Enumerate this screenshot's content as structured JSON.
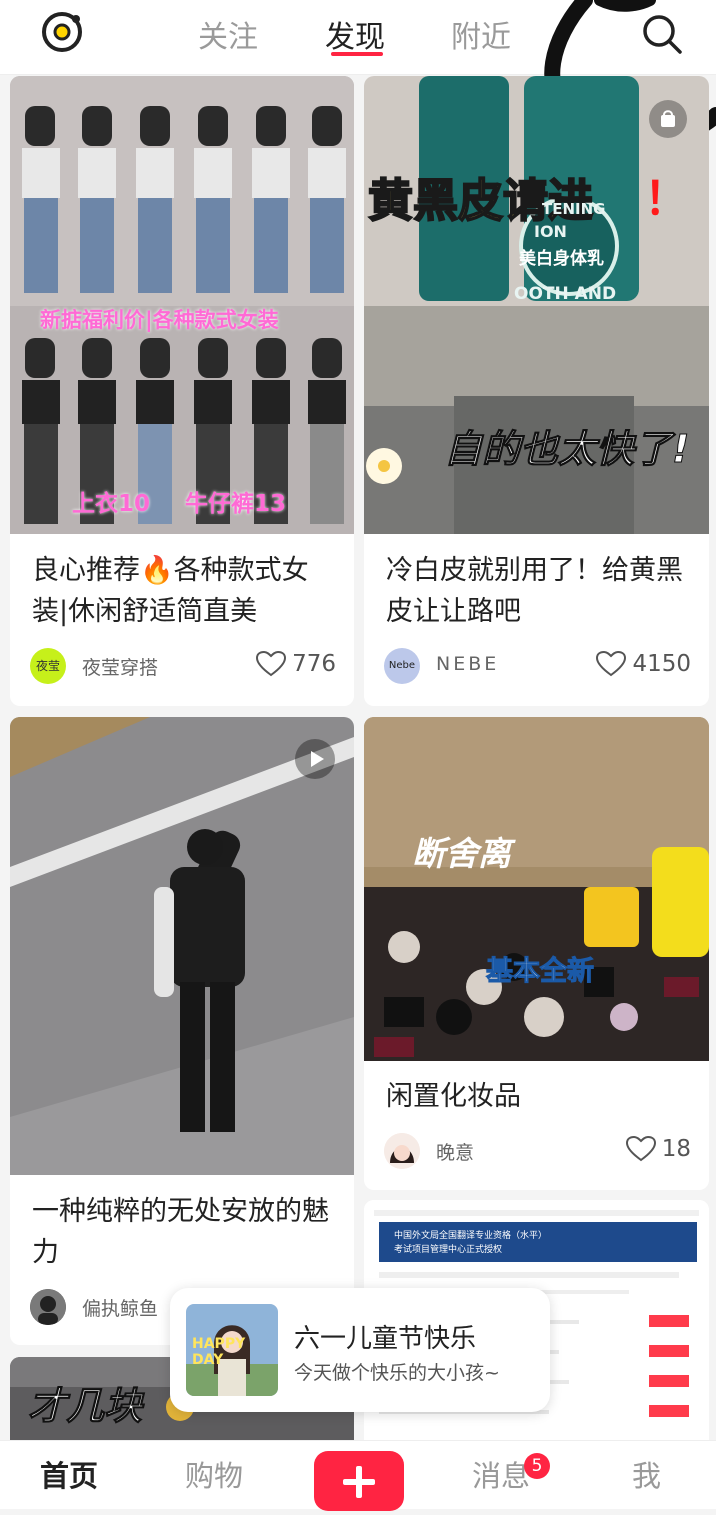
{
  "header": {
    "tabs": [
      {
        "label": "关注",
        "active": false
      },
      {
        "label": "发现",
        "active": true
      },
      {
        "label": "附近",
        "active": false
      }
    ],
    "accent_color": "#ff2442"
  },
  "feed": [
    {
      "image_text": [
        "新掂福利价|各种款式女装",
        "上衣10",
        "牛仔裤13"
      ],
      "title": "良心推荐🔥各种款式女装|休闲舒适简直美",
      "author": "夜莹穿搭",
      "author_avatar_text": "夜莹",
      "likes": "776"
    },
    {
      "image_text": [
        "黄黑皮请进",
        "！",
        "自的也太快了!",
        "美白身体乳",
        "TENING",
        "ION",
        "OOTH AND"
      ],
      "title": "冷白皮就别用了！给黄黑皮让让路吧",
      "author": "NEBE",
      "author_avatar_text": "Nebe",
      "likes": "4150"
    },
    {
      "image_text": [],
      "title": "一种纯粹的无处安放的魅力",
      "author": "偏执鲸鱼",
      "likes": ""
    },
    {
      "image_text": [
        "断舍离",
        "基本全新"
      ],
      "title": "闲置化妆品",
      "author": "晚意",
      "likes": "18"
    },
    {
      "image_text": [
        "才几块"
      ],
      "title": "",
      "author": "",
      "likes": ""
    },
    {
      "image_text": [
        "中国外文局全国翻译专业资格（水平）",
        "考试项目管理中心正式授权"
      ],
      "title": "",
      "author": "",
      "likes": ""
    }
  ],
  "popup": {
    "title": "六一儿童节快乐",
    "subtitle": "今天做个快乐的大小孩~",
    "thumb_text": "HAPPY DAY"
  },
  "bottom_nav": {
    "items": [
      {
        "label": "首页",
        "active": true
      },
      {
        "label": "购物",
        "active": false
      },
      {
        "label": "消息",
        "active": false,
        "badge": "5"
      },
      {
        "label": "我",
        "active": false
      }
    ]
  }
}
